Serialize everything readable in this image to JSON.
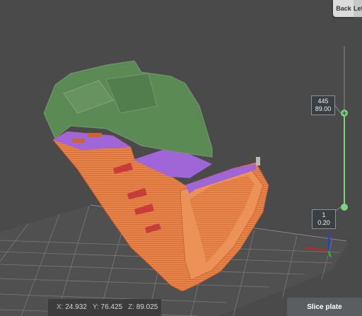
{
  "view_cube": {
    "back": "Back",
    "left": "Left"
  },
  "layer_slider": {
    "top_layer": "445",
    "top_height": "89.00",
    "bottom_layer": "1",
    "bottom_height": "0.20"
  },
  "coordinates": {
    "x_label": "X:",
    "x": "24.932",
    "y_label": "Y:",
    "y": "76.425",
    "z_label": "Z:",
    "z": "89.025"
  },
  "slice_button": "Slice plate",
  "colors": {
    "background": "#4a4a4a",
    "model_orange": "#e8844a",
    "top_purple": "#a066d8",
    "overhang_red": "#c83c3c",
    "preview_green": "#6bbf5e",
    "slider_green": "#7ad47f"
  }
}
